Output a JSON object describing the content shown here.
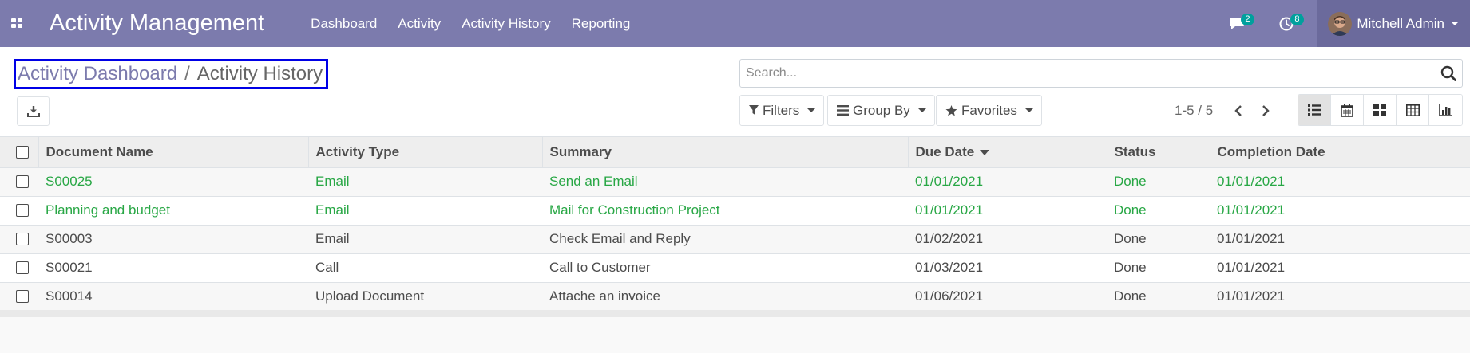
{
  "navbar": {
    "app_title": "Activity Management",
    "menu": [
      "Dashboard",
      "Activity",
      "Activity History",
      "Reporting"
    ],
    "messages_count": "2",
    "activities_count": "8",
    "user_name": "Mitchell Admin",
    "bg_color": "#7c7bad"
  },
  "breadcrumb": {
    "parent": "Activity Dashboard",
    "separator": "/",
    "current": "Activity History"
  },
  "search": {
    "placeholder": "Search..."
  },
  "filters": {
    "filters_label": "Filters",
    "group_by_label": "Group By",
    "favorites_label": "Favorites"
  },
  "pager": {
    "value": "1-5 / 5"
  },
  "views": [
    "list-icon",
    "calendar-icon",
    "kanban-icon",
    "pivot-icon",
    "graph-icon"
  ],
  "table": {
    "columns": [
      "Document Name",
      "Activity Type",
      "Summary",
      "Due Date",
      "Status",
      "Completion Date"
    ],
    "sorted_column": "Due Date",
    "rows": [
      {
        "document": "S00025",
        "type": "Email",
        "summary": "Send an Email",
        "due": "01/01/2021",
        "status": "Done",
        "completion": "01/01/2021",
        "style": "green"
      },
      {
        "document": "Planning and budget",
        "type": "Email",
        "summary": "Mail for Construction Project",
        "due": "01/01/2021",
        "status": "Done",
        "completion": "01/01/2021",
        "style": "green"
      },
      {
        "document": "S00003",
        "type": "Email",
        "summary": "Check Email and Reply",
        "due": "01/02/2021",
        "status": "Done",
        "completion": "01/01/2021",
        "style": "normal"
      },
      {
        "document": "S00021",
        "type": "Call",
        "summary": "Call to Customer",
        "due": "01/03/2021",
        "status": "Done",
        "completion": "01/01/2021",
        "style": "normal"
      },
      {
        "document": "S00014",
        "type": "Upload Document",
        "summary": "Attache an invoice",
        "due": "01/06/2021",
        "status": "Done",
        "completion": "01/01/2021",
        "style": "normal"
      }
    ]
  },
  "colors": {
    "accent": "#7c7bad",
    "success": "#28a745",
    "badge": "#00a09d",
    "highlight_border": "#0000e6"
  }
}
